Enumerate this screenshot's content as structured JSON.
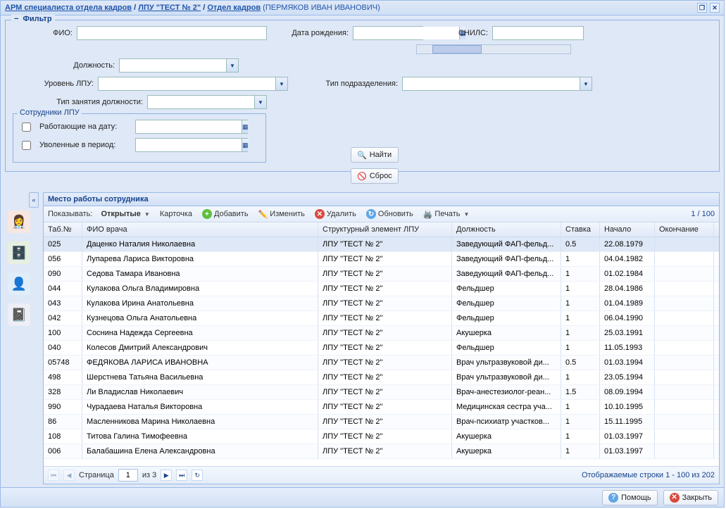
{
  "window": {
    "title_crumb1": "АРМ специалиста отдела кадров",
    "sep": " / ",
    "title_crumb2": "ЛПУ \"ТЕСТ № 2\"",
    "title_crumb3": "Отдел кадров",
    "user": "(ПЕРМЯКОВ ИВАН ИВАНОВИЧ)"
  },
  "filter": {
    "legend": "Фильтр",
    "fio_label": "ФИО:",
    "dob_label": "Дата рождения:",
    "snils_label": "СНИЛС:",
    "post_label": "Должность:",
    "lpu_level_label": "Уровень ЛПУ:",
    "dept_type_label": "Тип подразделения:",
    "occ_type_label": "Тип занятия должности:"
  },
  "staff_sub": {
    "legend": "Сотрудники ЛПУ",
    "working_label": "Работающие на дату:",
    "fired_label": "Уволенные в период:"
  },
  "buttons": {
    "find": "Найти",
    "reset": "Сброс",
    "help": "Помощь",
    "close": "Закрыть"
  },
  "grid": {
    "title": "Место работы сотрудника",
    "show_label": "Показывать:",
    "show_value": "Открытые",
    "card": "Карточка",
    "add": "Добавить",
    "edit": "Изменить",
    "delete": "Удалить",
    "refresh": "Обновить",
    "print": "Печать",
    "count": "1 / 100",
    "cols": {
      "tab": "Таб.№",
      "fio": "ФИО врача",
      "lpu": "Структурный элемент ЛПУ",
      "job": "Должность",
      "rate": "Ставка",
      "start": "Начало",
      "end": "Окончание"
    },
    "rows": [
      {
        "tab": "025",
        "fio": "Даценко Наталия Николаевна",
        "lpu": "ЛПУ \"ТЕСТ № 2\"",
        "job": "Заведующий ФАП-фельд...",
        "rate": "0.5",
        "start": "22.08.1979",
        "end": ""
      },
      {
        "tab": "056",
        "fio": "Лупарева Лариса Викторовна",
        "lpu": "ЛПУ \"ТЕСТ № 2\"",
        "job": "Заведующий ФАП-фельд...",
        "rate": "1",
        "start": "04.04.1982",
        "end": ""
      },
      {
        "tab": "090",
        "fio": "Седова Тамара Ивановна",
        "lpu": "ЛПУ \"ТЕСТ № 2\"",
        "job": "Заведующий ФАП-фельд...",
        "rate": "1",
        "start": "01.02.1984",
        "end": ""
      },
      {
        "tab": "044",
        "fio": "Кулакова Ольга Владимировна",
        "lpu": "ЛПУ \"ТЕСТ № 2\"",
        "job": "Фельдшер",
        "rate": "1",
        "start": "28.04.1986",
        "end": ""
      },
      {
        "tab": "043",
        "fio": "Кулакова Ирина Анатольевна",
        "lpu": "ЛПУ \"ТЕСТ № 2\"",
        "job": "Фельдшер",
        "rate": "1",
        "start": "01.04.1989",
        "end": ""
      },
      {
        "tab": "042",
        "fio": "Кузнецова Ольга Анатольевна",
        "lpu": "ЛПУ \"ТЕСТ № 2\"",
        "job": "Фельдшер",
        "rate": "1",
        "start": "06.04.1990",
        "end": ""
      },
      {
        "tab": "100",
        "fio": "Соснина Надежда Сергеевна",
        "lpu": "ЛПУ \"ТЕСТ № 2\"",
        "job": "Акушерка",
        "rate": "1",
        "start": "25.03.1991",
        "end": ""
      },
      {
        "tab": "040",
        "fio": "Колесов Дмитрий Александрович",
        "lpu": "ЛПУ \"ТЕСТ № 2\"",
        "job": "Фельдшер",
        "rate": "1",
        "start": "11.05.1993",
        "end": ""
      },
      {
        "tab": "05748",
        "fio": "ФЕДЯКОВА ЛАРИСА ИВАНОВНА",
        "lpu": "ЛПУ \"ТЕСТ № 2\"",
        "job": "Врач ультразвуковой ди...",
        "rate": "0.5",
        "start": "01.03.1994",
        "end": ""
      },
      {
        "tab": "498",
        "fio": "Шерстнева Татьяна Васильевна",
        "lpu": "ЛПУ \"ТЕСТ № 2\"",
        "job": "Врач ультразвуковой ди...",
        "rate": "1",
        "start": "23.05.1994",
        "end": ""
      },
      {
        "tab": "328",
        "fio": "Ли Владислав Николаевич",
        "lpu": "ЛПУ \"ТЕСТ № 2\"",
        "job": "Врач-анестезиолог-реан...",
        "rate": "1.5",
        "start": "08.09.1994",
        "end": ""
      },
      {
        "tab": "990",
        "fio": "Чурадаева Наталья Викторовна",
        "lpu": "ЛПУ \"ТЕСТ № 2\"",
        "job": "Медицинская сестра уча...",
        "rate": "1",
        "start": "10.10.1995",
        "end": ""
      },
      {
        "tab": "86",
        "fio": "Масленникова Марина Николаевна",
        "lpu": "ЛПУ \"ТЕСТ № 2\"",
        "job": "Врач-психиатр участков...",
        "rate": "1",
        "start": "15.11.1995",
        "end": ""
      },
      {
        "tab": "108",
        "fio": "Титова Галина Тимофеевна",
        "lpu": "ЛПУ \"ТЕСТ № 2\"",
        "job": "Акушерка",
        "rate": "1",
        "start": "01.03.1997",
        "end": ""
      },
      {
        "tab": "006",
        "fio": "Балабашина Елена Александровна",
        "lpu": "ЛПУ \"ТЕСТ № 2\"",
        "job": "Акушерка",
        "rate": "1",
        "start": "01.03.1997",
        "end": ""
      }
    ],
    "pager": {
      "page_label": "Страница",
      "page": "1",
      "of": "из 3",
      "status": "Отображаемые строки 1 - 100 из 202"
    }
  }
}
